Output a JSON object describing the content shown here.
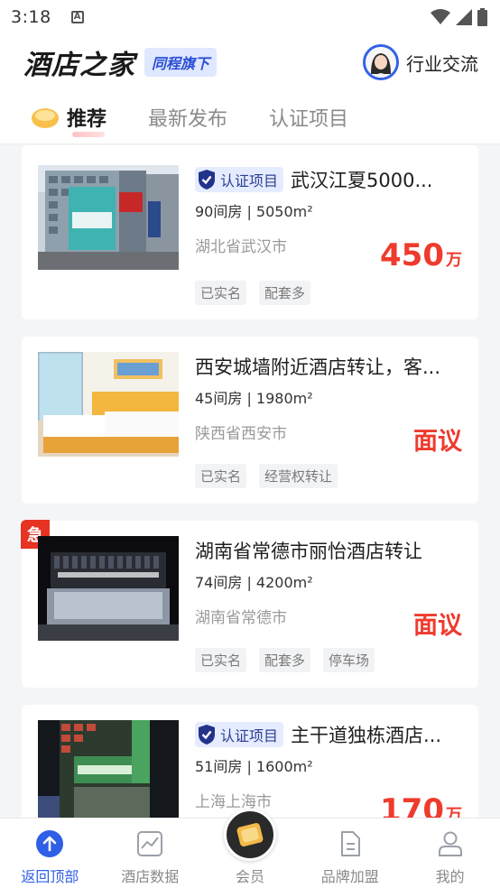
{
  "status_bar": {
    "time": "3:18"
  },
  "header": {
    "logo_text": "酒店之家",
    "logo_badge": "同程旗下",
    "community_label": "行业交流"
  },
  "tabs": [
    {
      "label": "推荐",
      "active": true
    },
    {
      "label": "最新发布",
      "active": false
    },
    {
      "label": "认证项目",
      "active": false
    }
  ],
  "listings": [
    {
      "certified": true,
      "cert_label": "认证项目",
      "title": "武汉江夏5000...",
      "specs": "90间房 | 5050m²",
      "location": "湖北省武汉市",
      "price": "450",
      "price_unit": "万",
      "tags": [
        "已实名",
        "配套多"
      ],
      "urgent": false
    },
    {
      "certified": false,
      "title": "西安城墙附近酒店转让，客...",
      "specs": "45间房 | 1980m²",
      "location": "陕西省西安市",
      "price": "面议",
      "price_unit": "",
      "tags": [
        "已实名",
        "经营权转让"
      ],
      "urgent": false
    },
    {
      "certified": false,
      "title": "湖南省常德市丽怡酒店转让",
      "specs": "74间房 | 4200m²",
      "location": "湖南省常德市",
      "price": "面议",
      "price_unit": "",
      "tags": [
        "已实名",
        "配套多",
        "停车场"
      ],
      "urgent": true,
      "urgent_label": "急"
    },
    {
      "certified": true,
      "cert_label": "认证项目",
      "title": "主干道独栋酒店...",
      "specs": "51间房 | 1600m²",
      "location": "上海上海市",
      "price": "170",
      "price_unit": "万",
      "tags": [],
      "urgent": false
    }
  ],
  "bottom_nav": [
    {
      "label": "返回顶部",
      "icon": "arrow-up-icon",
      "active": true
    },
    {
      "label": "酒店数据",
      "icon": "chart-icon",
      "active": false
    },
    {
      "label": "会员",
      "icon": "member-icon",
      "active": false
    },
    {
      "label": "品牌加盟",
      "icon": "document-icon",
      "active": false
    },
    {
      "label": "我的",
      "icon": "user-icon",
      "active": false
    }
  ],
  "colors": {
    "accent": "#2f5fe6",
    "price": "#ee3b2d",
    "urgent": "#e63323"
  }
}
